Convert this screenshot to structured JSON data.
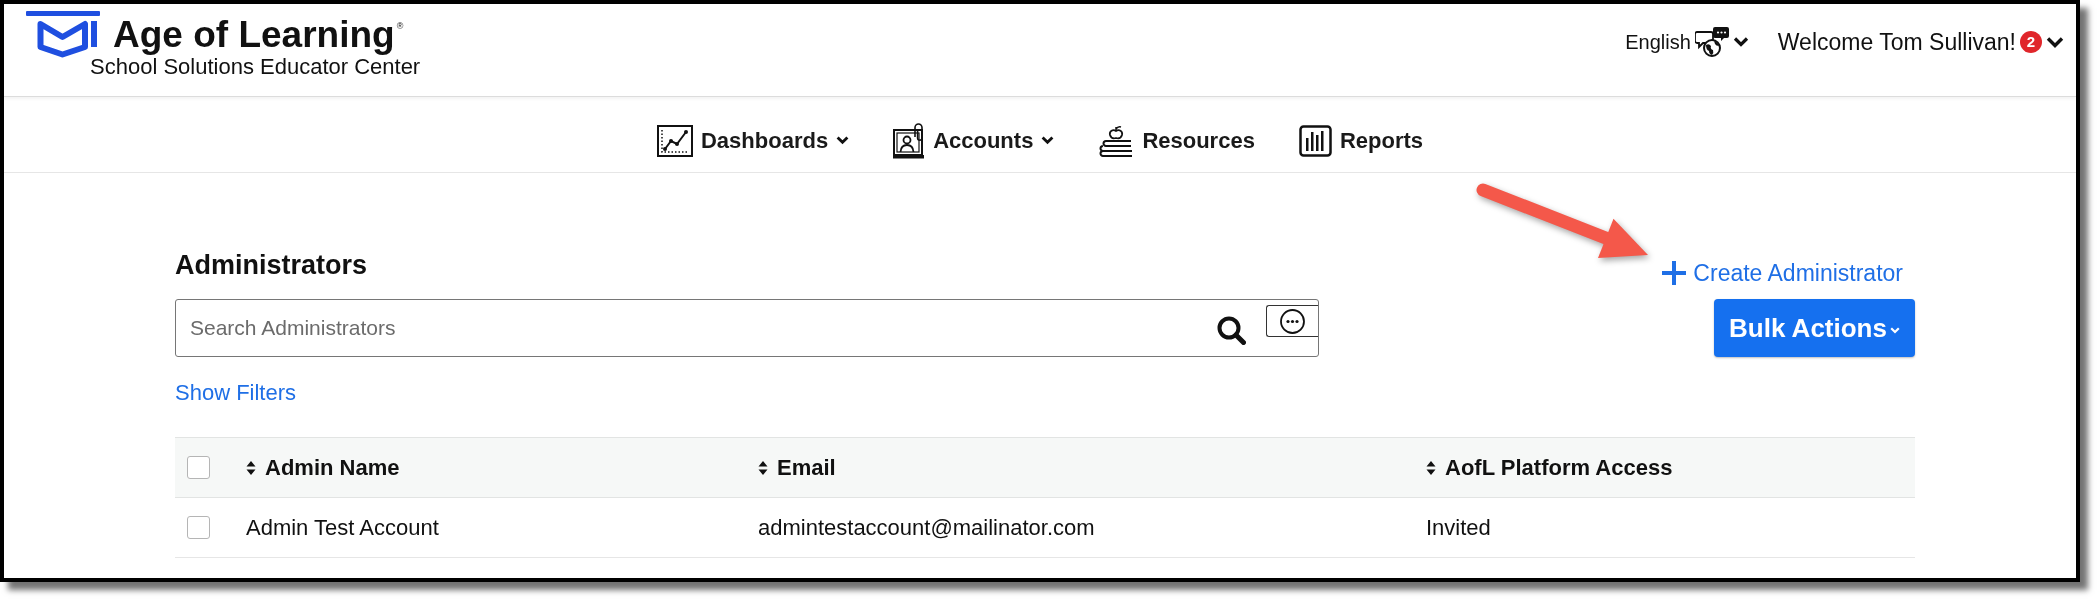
{
  "header": {
    "brand": "Age of Learning$^{®}$",
    "subtitle": "School Solutions Educator Center",
    "language": {
      "label": "English",
      "has_menu": true
    },
    "user": {
      "welcome": "Welcome Tom Sullivan!",
      "notifications": "2",
      "has_menu": true
    }
  },
  "nav": [
    {
      "label": "Dashboards",
      "has_menu": true
    },
    {
      "label": "Accounts",
      "has_menu": true
    },
    {
      "label": "Resources",
      "has_menu": false
    },
    {
      "label": "Reports",
      "has_menu": false
    }
  ],
  "administrators": {
    "title": "Administrators",
    "create_link": "Create Administrator",
    "search": {
      "placeholder": "Search Administrators"
    },
    "bulk_actions": "Bulk Actions",
    "show_filters": "Show Filters"
  },
  "table": {
    "select_all": {
      "checked": false
    },
    "columns": [
      {
        "label": "Admin Name",
        "sortable": true
      },
      {
        "label": "Email",
        "sortable": true
      },
      {
        "label": "AofL Platform Access",
        "sortable": true
      }
    ],
    "rows": [
      {
        "checked": false,
        "cells": [
          "Admin Test Account",
          "admintestaccount@mailinator.com",
          "Invited"
        ]
      }
    ]
  }
}
